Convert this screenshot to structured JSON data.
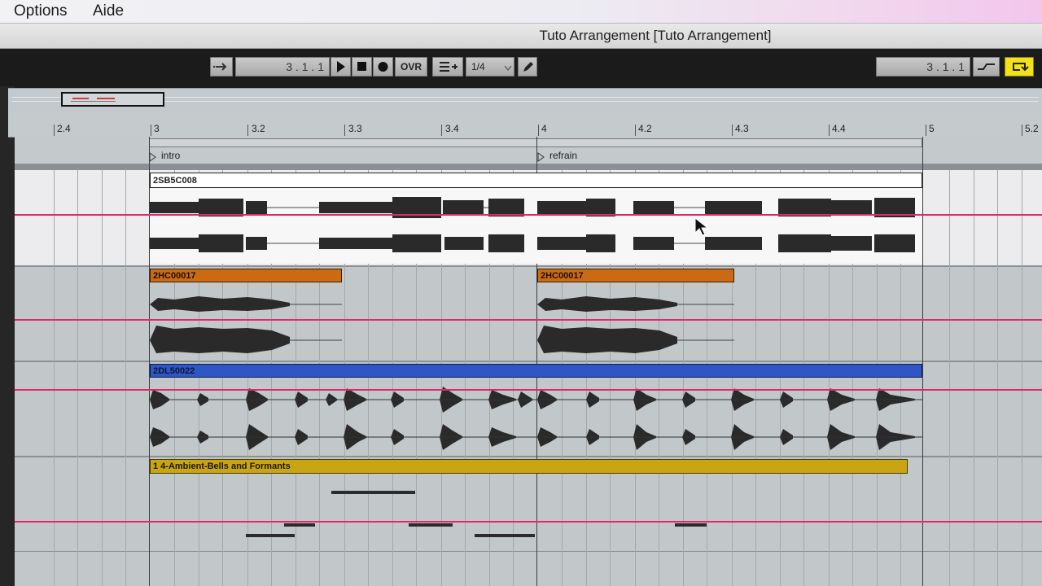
{
  "menubar": {
    "options": "Options",
    "aide": "Aide"
  },
  "window": {
    "title": "Tuto Arrangement  [Tuto Arrangement]"
  },
  "transport": {
    "follow_icon": "follow-arrow-icon",
    "song_position": "3 .  1 .  1",
    "play_icon": "play-icon",
    "stop_icon": "stop-icon",
    "record_icon": "record-icon",
    "ovr_label": "OVR",
    "quantize_icon": "quantize-menu-icon",
    "quantize_value": "1/4",
    "draw_icon": "pencil-icon",
    "loop_start": "3 .  1 .  1",
    "punch_icon": "punch-in-icon",
    "loop_icon": "loop-switch-icon"
  },
  "ruler": {
    "labels": [
      "2.4",
      "3",
      "3.2",
      "3.3",
      "3.4",
      "4",
      "4.2",
      "4.3",
      "4.4",
      "5",
      "5.2"
    ]
  },
  "locators": {
    "intro": "intro",
    "refrain": "refrain"
  },
  "tracks": [
    {
      "clips": [
        {
          "name": "2SB5C008",
          "color": "#ffffff"
        }
      ]
    },
    {
      "clips": [
        {
          "name": "2HC00017",
          "color": "#cc6a14"
        },
        {
          "name": "2HC00017",
          "color": "#cc6a14"
        }
      ]
    },
    {
      "clips": [
        {
          "name": "2DL50022",
          "color": "#2f56c7"
        }
      ]
    },
    {
      "clips": [
        {
          "name": "1 4-Ambient-Bells and Formants",
          "color": "#c9a511"
        }
      ]
    }
  ],
  "colors": {
    "selection_line": "#e2276a",
    "lane_bg": "#c2c7ca",
    "highlight_lane_bg": "#ececef",
    "loop_switch_on": "#f2e21a"
  }
}
